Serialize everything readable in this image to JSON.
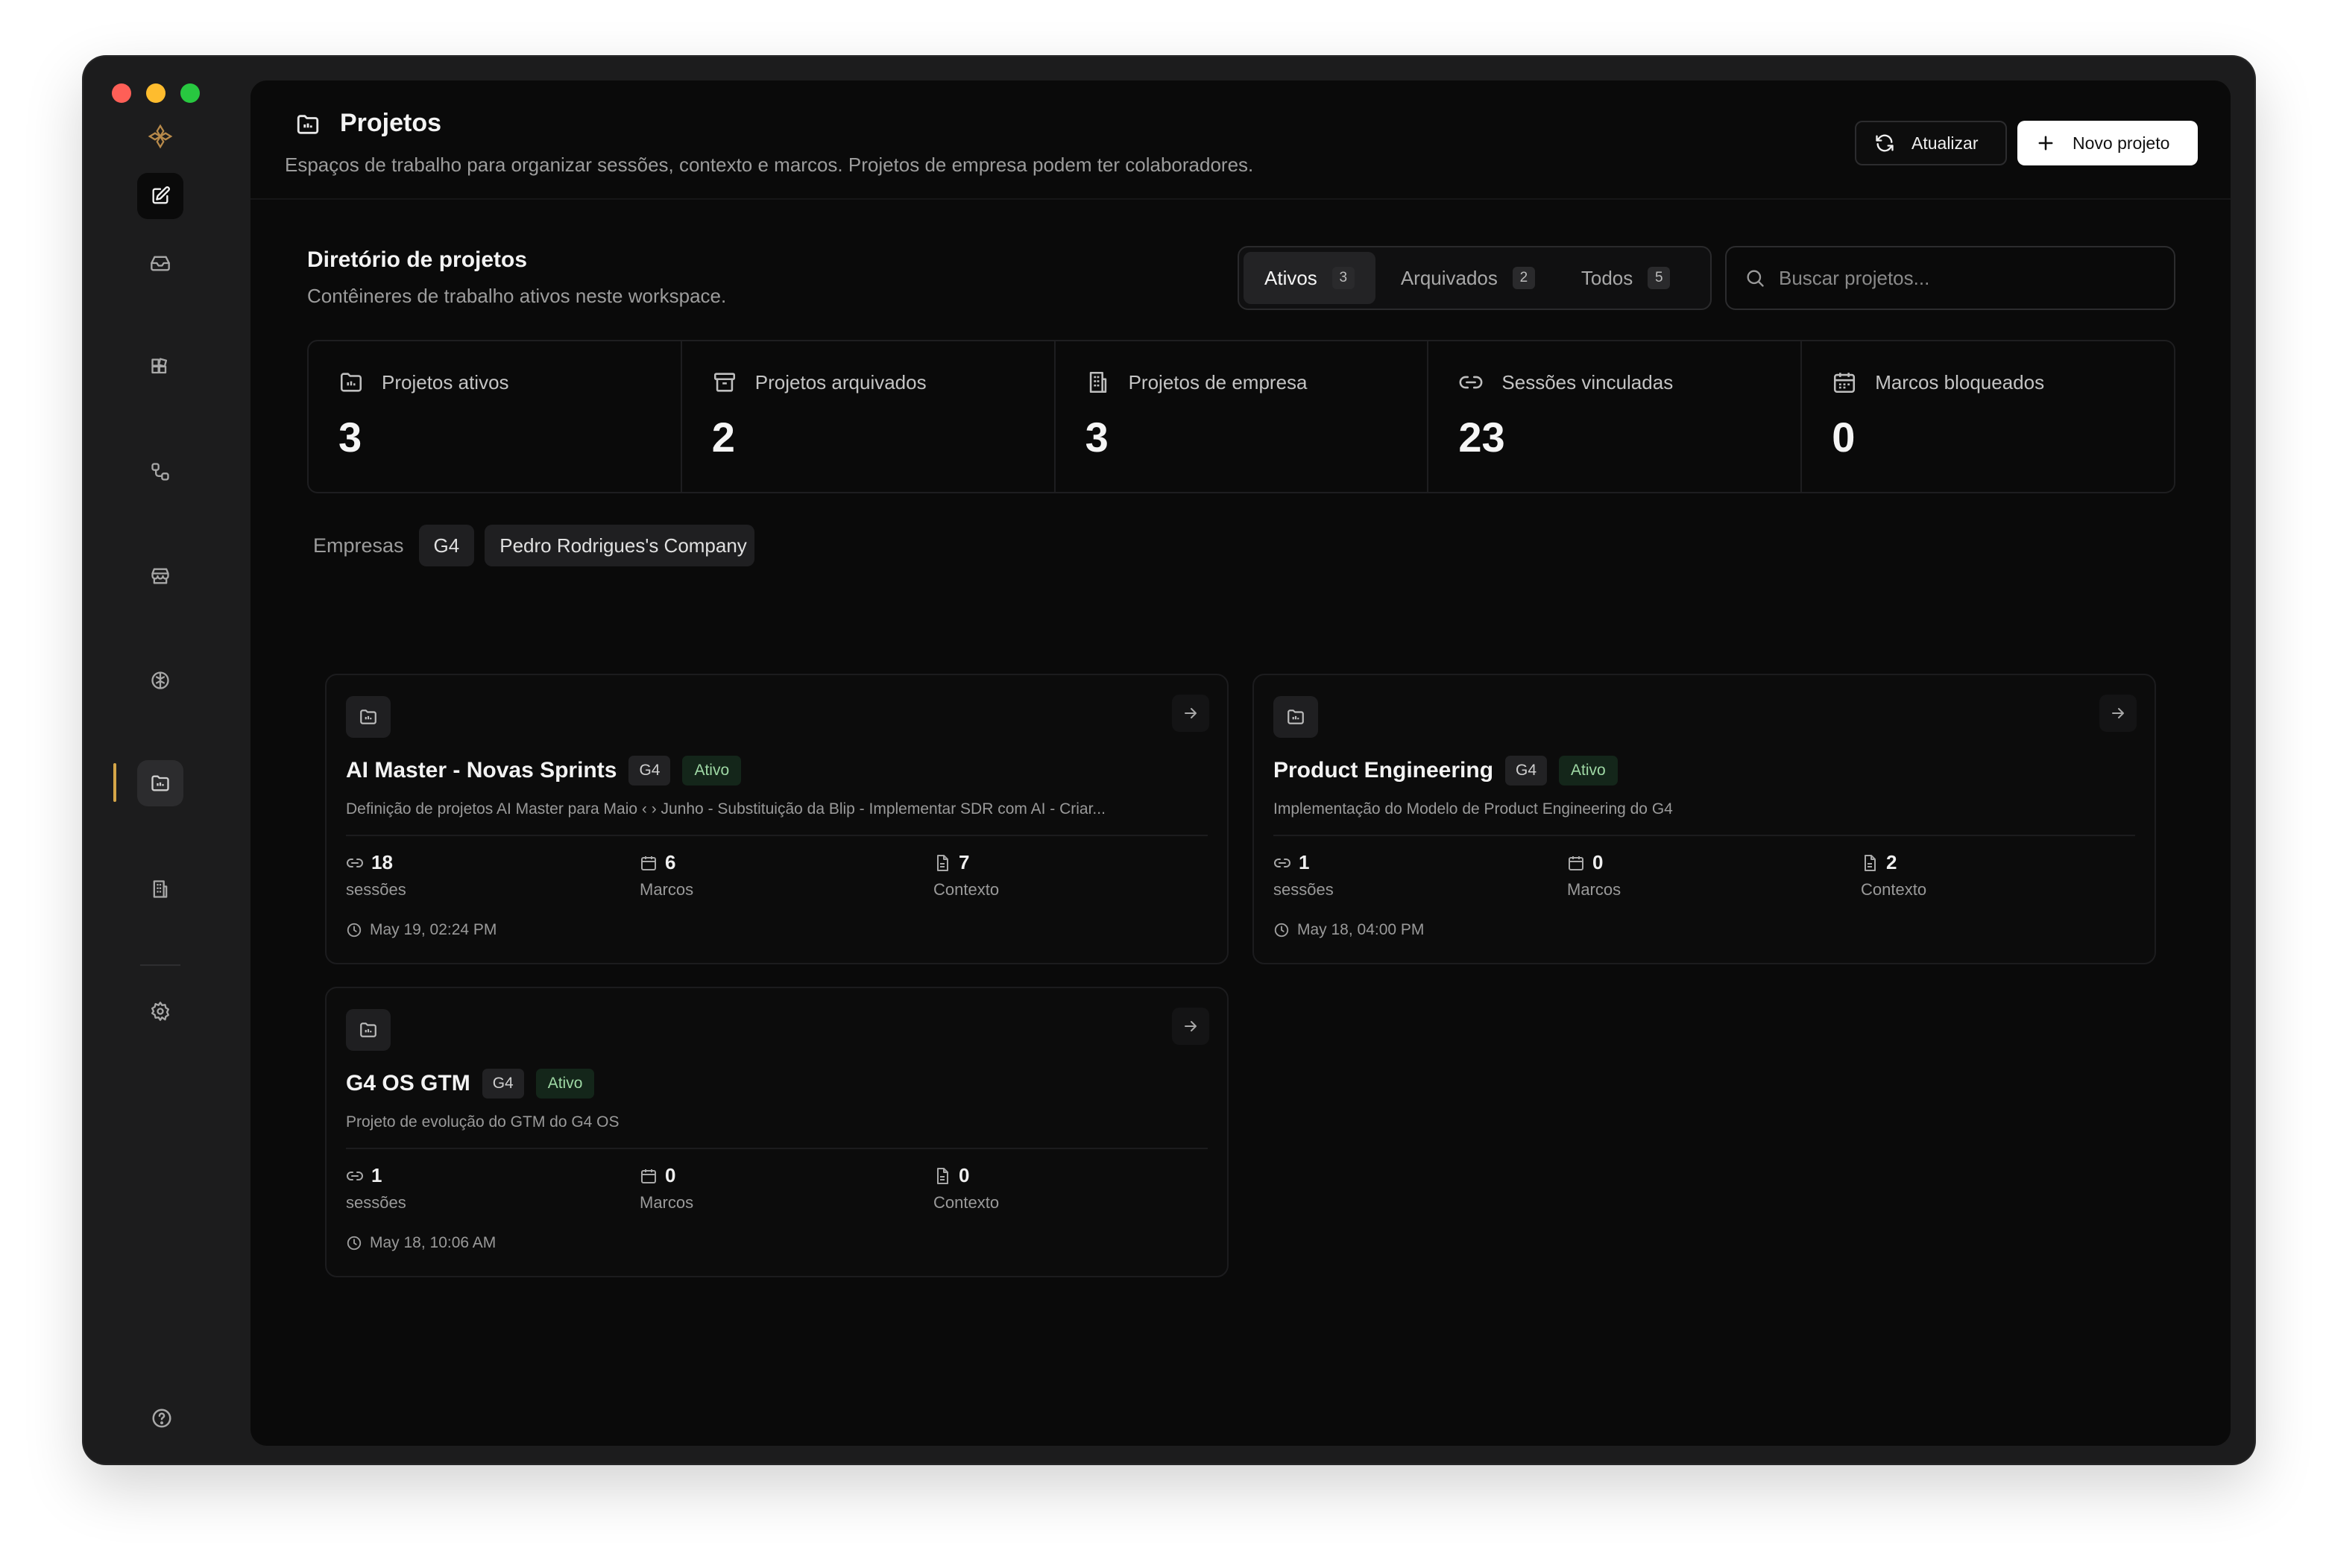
{
  "header": {
    "title": "Projetos",
    "subtitle": "Espaços de trabalho para organizar sessões, contexto e marcos. Projetos de empresa podem ter colaboradores.",
    "refresh_label": "Atualizar",
    "new_label": "Novo projeto"
  },
  "directory": {
    "title": "Diretório de projetos",
    "subtitle": "Contêineres de trabalho ativos neste workspace."
  },
  "tabs": [
    {
      "label": "Ativos",
      "count": "3",
      "selected": true
    },
    {
      "label": "Arquivados",
      "count": "2",
      "selected": false
    },
    {
      "label": "Todos",
      "count": "5",
      "selected": false
    }
  ],
  "search": {
    "placeholder": "Buscar projetos..."
  },
  "stats": [
    {
      "label": "Projetos ativos",
      "value": "3",
      "icon": "folder-icon"
    },
    {
      "label": "Projetos arquivados",
      "value": "2",
      "icon": "archive-icon"
    },
    {
      "label": "Projetos de empresa",
      "value": "3",
      "icon": "building-icon"
    },
    {
      "label": "Sessões vinculadas",
      "value": "23",
      "icon": "link-icon"
    },
    {
      "label": "Marcos bloqueados",
      "value": "0",
      "icon": "calendar-icon"
    }
  ],
  "filters": {
    "label": "Empresas",
    "chips": [
      "G4",
      "Pedro Rodrigues's Company"
    ]
  },
  "projects": [
    {
      "title": "AI Master - Novas Sprints",
      "company": "G4",
      "status": "Ativo",
      "description": "Definição de projetos AI Master para Maio ‹ › Junho - Substituição da Blip - Implementar SDR com AI - Criar...",
      "sessions": "18",
      "sessions_label": "sessões",
      "milestones": "6",
      "milestones_label": "Marcos",
      "context": "7",
      "context_label": "Contexto",
      "updated": "May 19, 02:24 PM"
    },
    {
      "title": "Product Engineering",
      "company": "G4",
      "status": "Ativo",
      "description": "Implementação do Modelo de Product Engineering do G4",
      "sessions": "1",
      "sessions_label": "sessões",
      "milestones": "0",
      "milestones_label": "Marcos",
      "context": "2",
      "context_label": "Contexto",
      "updated": "May 18, 04:00 PM"
    },
    {
      "title": "G4 OS GTM",
      "company": "G4",
      "status": "Ativo",
      "description": "Projeto de evolução do GTM do G4 OS",
      "sessions": "1",
      "sessions_label": "sessões",
      "milestones": "0",
      "milestones_label": "Marcos",
      "context": "0",
      "context_label": "Contexto",
      "updated": "May 18, 10:06 AM"
    }
  ],
  "colors": {
    "accent": "#d4a548",
    "status_bg": "#14261a",
    "status_text": "#9fd9a5",
    "background": "#0a0a0a"
  }
}
